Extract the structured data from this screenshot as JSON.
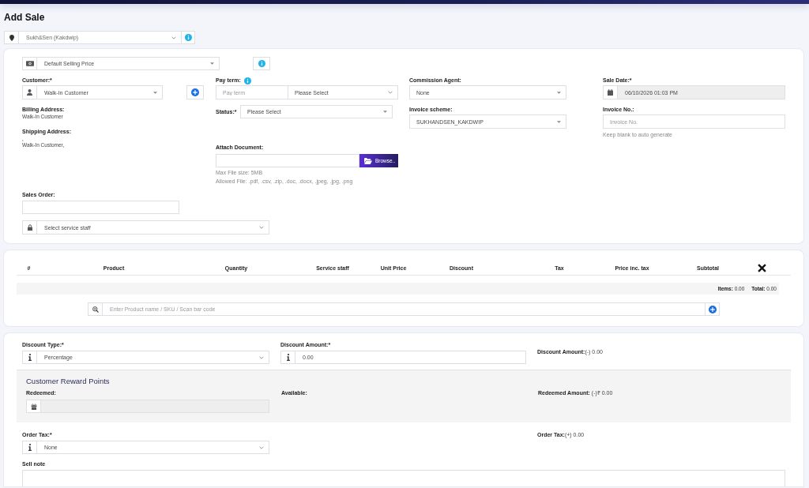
{
  "page": {
    "title": "Add Sale"
  },
  "location": {
    "value": "Sukh&Sen (Kakdwip)"
  },
  "price_group": {
    "value": "Default Selling Price"
  },
  "customer": {
    "label": "Customer:*",
    "value": "Walk-In Customer"
  },
  "billing_address": {
    "label": "Billing Address:",
    "lines": [
      "Walk-In Customer"
    ]
  },
  "shipping_address": {
    "label": "Shipping Address:",
    "lines": [
      ",",
      "Walk-In Customer,"
    ]
  },
  "pay_term": {
    "label": "Pay term:",
    "placeholder": "Pay term",
    "period": "Please Select"
  },
  "status": {
    "label": "Status:*",
    "value": "Please Select"
  },
  "attach_document": {
    "label": "Attach Document:",
    "button": "Browse..",
    "help": [
      "Max File size: 5MB",
      "Allowed File: .pdf, .csv, .zip, .doc, .docx, .jpeg, .jpg, .png"
    ]
  },
  "commission_agent": {
    "label": "Commission Agent:",
    "value": "None"
  },
  "invoice_scheme": {
    "label": "Invoice scheme:",
    "value": "SUKHANDSEN_KAKDWIP"
  },
  "sale_date": {
    "label": "Sale Date:*",
    "value": "06/10/2026 01:03 PM",
    "disabled": true
  },
  "invoice_no": {
    "label": "Invoice No.:",
    "placeholder": "Invoice No.",
    "help": "Keep blank to auto generate"
  },
  "sales_order": {
    "label": "Sales Order:"
  },
  "service_staff": {
    "value": "Select service staff"
  },
  "products_table": {
    "columns": [
      "#",
      "Product",
      "Quantity",
      "Service staff",
      "Unit Price",
      "Discount",
      "Tax",
      "Price inc. tax",
      "Subtotal"
    ],
    "items": "**Items:** 0.00",
    "total": "**Total:** 0.00"
  },
  "product_search": {
    "placeholder": "Enter Product name / SKU / Scan bar code"
  },
  "discount_type": {
    "label": "Discount Type:*",
    "value": "Percentage"
  },
  "discount_amount": {
    "label": "Discount Amount:*",
    "value": "0.00"
  },
  "discount_summary": "**Discount Amount:**(-) 0.00",
  "reward_points": {
    "title": "Customer Reward Points",
    "redeemed": {
      "label": "Redeemed:",
      "disabled": true
    },
    "available": {
      "label": "Available:"
    },
    "redeemed_amount": "**Redeemed Amount:** (-)₹ 0.00"
  },
  "order_tax": {
    "label": "Order Tax:*",
    "value": "None"
  },
  "order_tax_summary": "**Order Tax:**(+) 0.00",
  "sell_note": {
    "label": "Sell note"
  }
}
